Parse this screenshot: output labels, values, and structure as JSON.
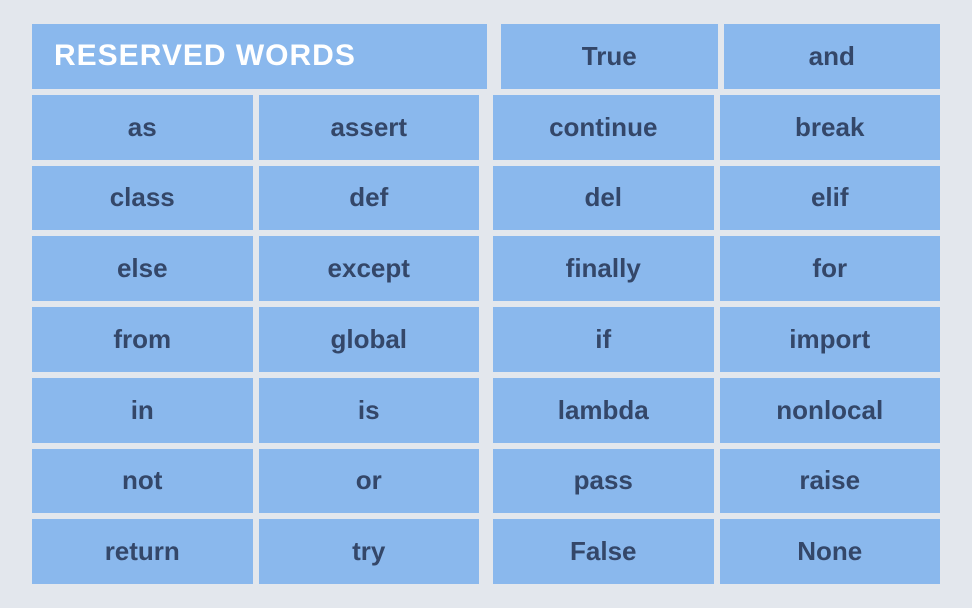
{
  "table": {
    "header": {
      "title": "RESERVED WORDS",
      "cells": [
        "True",
        "and"
      ]
    },
    "rows": [
      [
        "as",
        "assert",
        "continue",
        "break"
      ],
      [
        "class",
        "def",
        "del",
        "elif"
      ],
      [
        "else",
        "except",
        "finally",
        "for"
      ],
      [
        "from",
        "global",
        "if",
        "import"
      ],
      [
        "in",
        "is",
        "lambda",
        "nonlocal"
      ],
      [
        "not",
        "or",
        "pass",
        "raise"
      ],
      [
        "return",
        "try",
        "False",
        "None"
      ]
    ]
  }
}
